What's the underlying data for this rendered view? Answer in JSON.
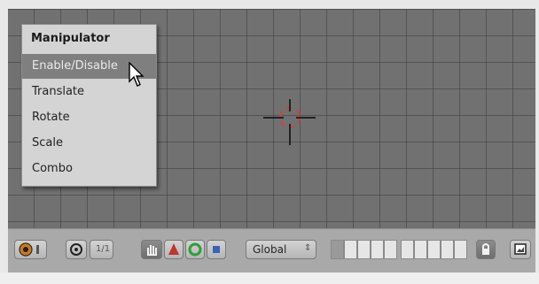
{
  "menu": {
    "title": "Manipulator",
    "items": [
      {
        "label": "Enable/Disable",
        "active": true
      },
      {
        "label": "Translate"
      },
      {
        "label": "Rotate"
      },
      {
        "label": "Scale"
      },
      {
        "label": "Combo"
      }
    ]
  },
  "toolbar": {
    "layer_value": "1/1",
    "orientation": "Global",
    "icons": [
      "object-mode-icon",
      "pivot-icon",
      "hand-icon",
      "cone-icon",
      "rotate-icon",
      "scale-icon",
      "lock-icon",
      "render-icon"
    ]
  },
  "colors": {
    "viewport": "#717171",
    "menu_bg": "#d4d4d4",
    "highlight": "#7f7f7f",
    "crosshair_red": "#d44040"
  }
}
